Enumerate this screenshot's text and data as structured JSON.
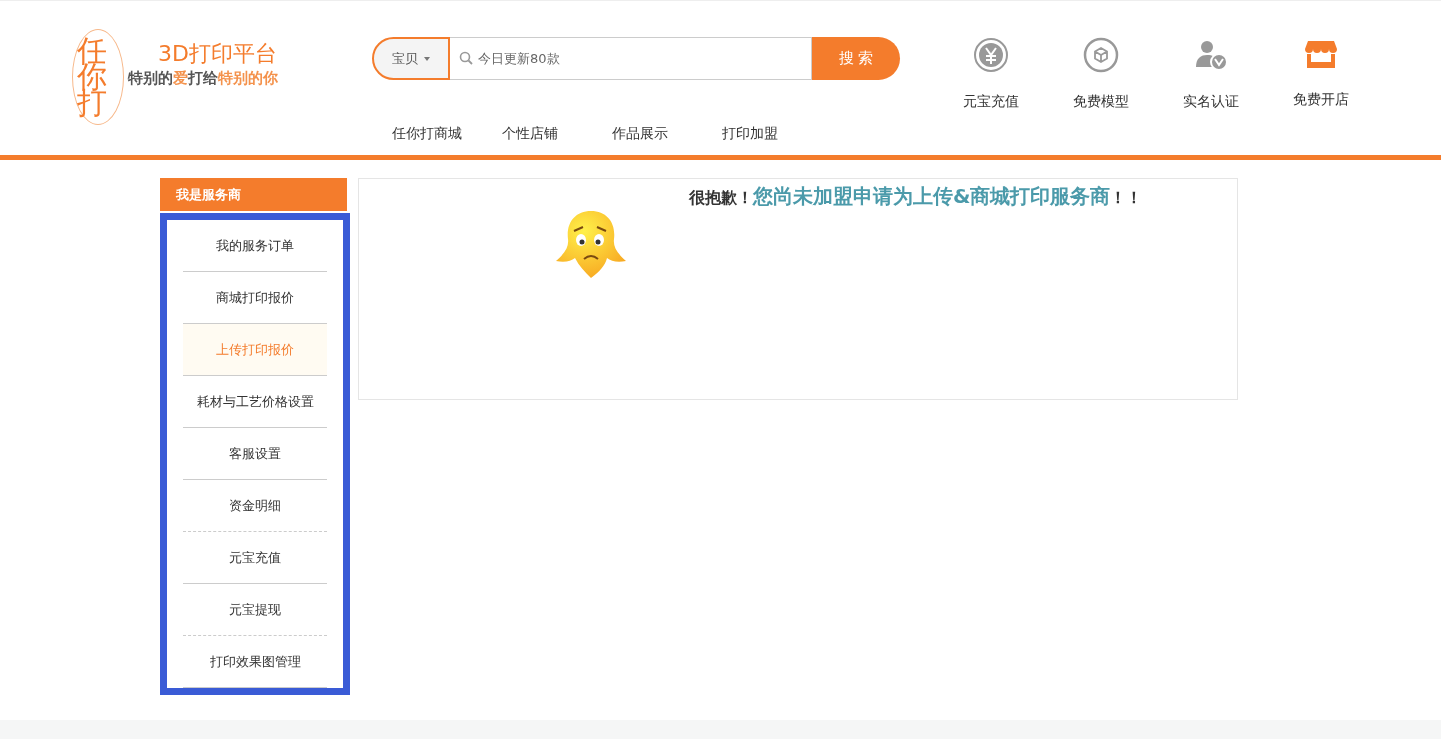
{
  "logo": {
    "mark": "任你打",
    "title": "3D打印平台",
    "slogan": [
      {
        "text": "特别的",
        "accent": false
      },
      {
        "text": "爱",
        "accent": true
      },
      {
        "text": "打给",
        "accent": false
      },
      {
        "text": "特别的你",
        "accent": true
      }
    ]
  },
  "search": {
    "category": "宝贝",
    "placeholder": "今日更新80款",
    "button": "搜 索"
  },
  "quick_links": [
    {
      "kind": "coin",
      "label": "元宝充值"
    },
    {
      "kind": "cube",
      "label": "免费模型"
    },
    {
      "kind": "verify",
      "label": "实名认证"
    },
    {
      "kind": "shop",
      "label": "免费开店"
    }
  ],
  "nav": [
    "任你打商城",
    "个性店铺",
    "作品展示",
    "打印加盟"
  ],
  "sidebar": {
    "title": "我是服务商",
    "items": [
      {
        "label": "我的服务订单",
        "selected": false,
        "dashed": false
      },
      {
        "label": "商城打印报价",
        "selected": false,
        "dashed": false
      },
      {
        "label": "上传打印报价",
        "selected": true,
        "dashed": false
      },
      {
        "label": "耗材与工艺价格设置",
        "selected": false,
        "dashed": false
      },
      {
        "label": "客服设置",
        "selected": false,
        "dashed": false
      },
      {
        "label": "资金明细",
        "selected": false,
        "dashed": true
      },
      {
        "label": "元宝充值",
        "selected": false,
        "dashed": false
      },
      {
        "label": "元宝提现",
        "selected": false,
        "dashed": true
      },
      {
        "label": "打印效果图管理",
        "selected": false,
        "dashed": false
      }
    ]
  },
  "notice": [
    {
      "kind": "plain",
      "text": "很抱歉！"
    },
    {
      "kind": "highlight",
      "text": "您尚未加盟申请为上传&商城打印服务商"
    },
    {
      "kind": "plain",
      "text": "！！"
    }
  ]
}
